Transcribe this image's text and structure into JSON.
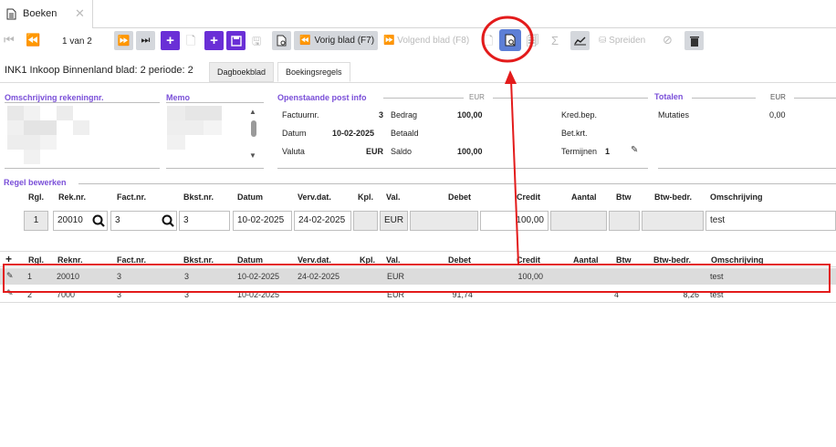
{
  "tab": {
    "title": "Boeken"
  },
  "toolbar": {
    "page_indicator": "1 van 2",
    "prev_sheet": "Vorig blad (F7)",
    "next_sheet": "Volgend blad (F8)",
    "sum_symbol": "Σ",
    "spread": "Spreiden"
  },
  "header": {
    "title": "INK1 Inkoop Binnenland blad: 2 periode: 2"
  },
  "subtabs": [
    "Dagboekblad",
    "Boekingsregels"
  ],
  "sections": {
    "account": "Omschrijving rekeningnr.",
    "memo": "Memo",
    "open_post": "Openstaande post info",
    "totals": "Totalen",
    "edit_line": "Regel bewerken"
  },
  "open_post": {
    "currency_header": "EUR",
    "factuurnr_label": "Factuurnr.",
    "factuurnr_value": "3",
    "bedrag_label": "Bedrag",
    "bedrag_value": "100,00",
    "datum_label": "Datum",
    "datum_value": "10-02-2025",
    "betaald_label": "Betaald",
    "valuta_label": "Valuta",
    "valuta_value": "EUR",
    "saldo_label": "Saldo",
    "saldo_value": "100,00",
    "kred_label": "Kred.bep.",
    "betkrt_label": "Bet.krt.",
    "termijnen_label": "Termijnen",
    "termijnen_value": "1"
  },
  "totals": {
    "currency_header": "EUR",
    "mutaties_label": "Mutaties",
    "mutaties_value": "0,00"
  },
  "edit_headers": [
    "Rgl.",
    "Rek.nr.",
    "Fact.nr.",
    "Bkst.nr.",
    "Datum",
    "Verv.dat.",
    "Kpl.",
    "Val.",
    "Debet",
    "Credit",
    "Aantal",
    "Btw",
    "Btw-bedr.",
    "Omschrijving"
  ],
  "edit_values": {
    "rgl": "1",
    "reknr": "20010",
    "factnr": "3",
    "bkstnr": "3",
    "datum": "10-02-2025",
    "vervdat": "24-02-2025",
    "kpl": "",
    "val": "EUR",
    "debet": "",
    "credit": "100,00",
    "aantal": "",
    "btw": "",
    "btwbedr": "",
    "omschrijving": "test"
  },
  "grid_headers": [
    "Rgl.",
    "Reknr.",
    "Fact.nr.",
    "Bkst.nr.",
    "Datum",
    "Verv.dat.",
    "Kpl.",
    "Val.",
    "Debet",
    "Credit",
    "Aantal",
    "Btw",
    "Btw-bedr.",
    "Omschrijving"
  ],
  "grid_rows": [
    {
      "rgl": "1",
      "reknr": "20010",
      "factnr": "3",
      "bkstnr": "3",
      "datum": "10-02-2025",
      "vervdat": "24-02-2025",
      "kpl": "",
      "val": "EUR",
      "debet": "",
      "credit": "100,00",
      "aantal": "",
      "btw": "",
      "btwbedr": "",
      "omschrijving": "test"
    },
    {
      "rgl": "2",
      "reknr": "7000",
      "factnr": "3",
      "bkstnr": "3",
      "datum": "10-02-2025",
      "vervdat": "",
      "kpl": "",
      "val": "EUR",
      "debet": "91,74",
      "credit": "",
      "aantal": "",
      "btw": "4",
      "btwbedr": "8,26",
      "omschrijving": "test"
    }
  ],
  "colors": {
    "accent": "#6a2fd6",
    "highlight": "#e31b1b",
    "selected_row": "#dcdcdc"
  }
}
